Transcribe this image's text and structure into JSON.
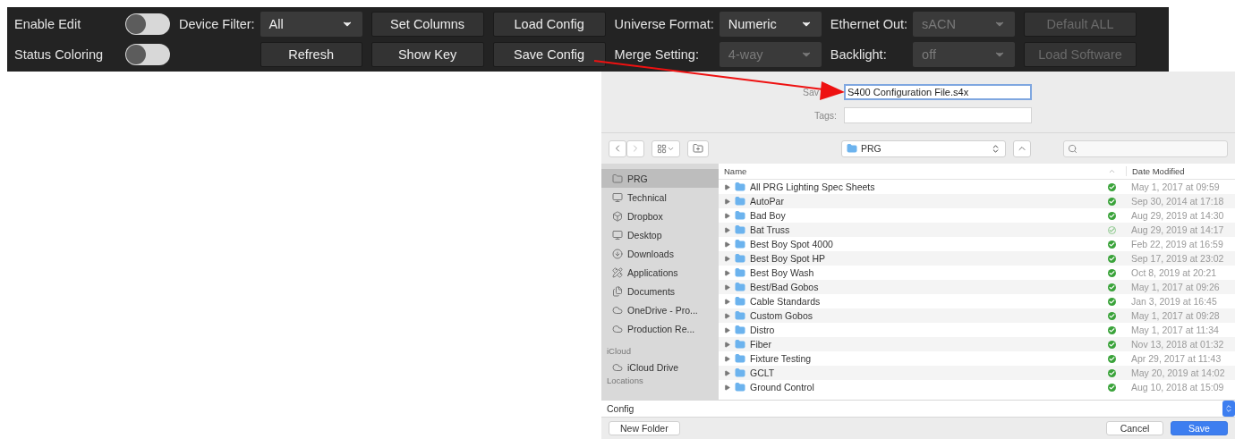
{
  "toolbar": {
    "groups": [
      {
        "kind": "toggles",
        "items": [
          {
            "label": "Enable Edit",
            "on": false
          },
          {
            "label": "Status Coloring",
            "on": false
          }
        ]
      },
      {
        "kind": "fields",
        "items": [
          {
            "kind": "dropdown",
            "label": "Device Filter:",
            "value": "All",
            "disabled": false
          },
          {
            "kind": "button",
            "text": "Refresh",
            "disabled": false
          }
        ]
      },
      {
        "kind": "buttons",
        "items": [
          {
            "text": "Set Columns",
            "disabled": false
          },
          {
            "text": "Show Key",
            "disabled": false
          }
        ]
      },
      {
        "kind": "buttons",
        "items": [
          {
            "text": "Load Config",
            "disabled": false
          },
          {
            "text": "Save Config",
            "disabled": false
          }
        ]
      },
      {
        "kind": "fields",
        "items": [
          {
            "kind": "dropdown",
            "label": "Universe Format:",
            "value": "Numeric",
            "disabled": false
          },
          {
            "kind": "dropdown",
            "label": "Merge Setting:",
            "value": "4-way",
            "disabled": true
          }
        ]
      },
      {
        "kind": "fields",
        "items": [
          {
            "kind": "dropdown",
            "label": "Ethernet Out:",
            "value": "sACN",
            "disabled": true
          },
          {
            "kind": "dropdown",
            "label": "Backlight:",
            "value": "off",
            "disabled": true
          }
        ]
      },
      {
        "kind": "buttons",
        "items": [
          {
            "text": "Default ALL",
            "disabled": true
          },
          {
            "text": "Load Software",
            "disabled": true
          }
        ]
      }
    ]
  },
  "save_dialog": {
    "save_as": {
      "label": "Sav",
      "value": "S400 Configuration File.s4x"
    },
    "tags": {
      "label": "Tags:"
    },
    "location": "PRG",
    "sidebar": [
      {
        "kind": "item",
        "label": "PRG",
        "selected": true
      },
      {
        "kind": "item",
        "label": "Technical",
        "selected": false
      },
      {
        "kind": "item",
        "label": "Dropbox",
        "selected": false
      },
      {
        "kind": "item",
        "label": "Desktop",
        "selected": false
      },
      {
        "kind": "item",
        "label": "Downloads",
        "selected": false
      },
      {
        "kind": "item",
        "label": "Applications",
        "selected": false
      },
      {
        "kind": "item",
        "label": "Documents",
        "selected": false
      },
      {
        "kind": "item",
        "label": "OneDrive - Pro...",
        "selected": false
      },
      {
        "kind": "item",
        "label": "Production Re...",
        "selected": false
      },
      {
        "kind": "heading",
        "label": "iCloud"
      },
      {
        "kind": "item",
        "label": "iCloud Drive",
        "selected": false
      },
      {
        "kind": "heading",
        "label": "Locations"
      }
    ],
    "columns": [
      "Name",
      "Date Modified"
    ],
    "rows": [
      {
        "name": "All PRG Lighting Spec Sheets",
        "date": "May 1, 2017 at 09:59",
        "synced": true
      },
      {
        "name": "AutoPar",
        "date": "Sep 30, 2014 at 17:18",
        "synced": true
      },
      {
        "name": "Bad Boy",
        "date": "Aug 29, 2019 at 14:30",
        "synced": true
      },
      {
        "name": "Bat Truss",
        "date": "Aug 29, 2019 at 14:17",
        "synced": false
      },
      {
        "name": "Best Boy Spot 4000",
        "date": "Feb 22, 2019 at 16:59",
        "synced": true
      },
      {
        "name": "Best Boy Spot HP",
        "date": "Sep 17, 2019 at 23:02",
        "synced": true
      },
      {
        "name": "Best Boy Wash",
        "date": "Oct 8, 2019 at 20:21",
        "synced": true
      },
      {
        "name": "Best/Bad Gobos",
        "date": "May 1, 2017 at 09:26",
        "synced": true
      },
      {
        "name": "Cable Standards",
        "date": "Jan 3, 2019 at 16:45",
        "synced": true
      },
      {
        "name": "Custom Gobos",
        "date": "May 1, 2017 at 09:28",
        "synced": true
      },
      {
        "name": "Distro",
        "date": "May 1, 2017 at 11:34",
        "synced": true
      },
      {
        "name": "Fiber",
        "date": "Nov 13, 2018 at 01:32",
        "synced": true
      },
      {
        "name": "Fixture Testing",
        "date": "Apr 29, 2017 at 11:43",
        "synced": true
      },
      {
        "name": "GCLT",
        "date": "May 20, 2019 at 14:02",
        "synced": true
      },
      {
        "name": "Ground Control",
        "date": "Aug 10, 2018 at 15:09",
        "synced": true
      }
    ],
    "format": "Config",
    "buttons": [
      {
        "text": "New Folder",
        "kind": "plain"
      },
      {
        "text": "Cancel",
        "kind": "plain"
      },
      {
        "text": "Save",
        "kind": "primary"
      }
    ]
  }
}
